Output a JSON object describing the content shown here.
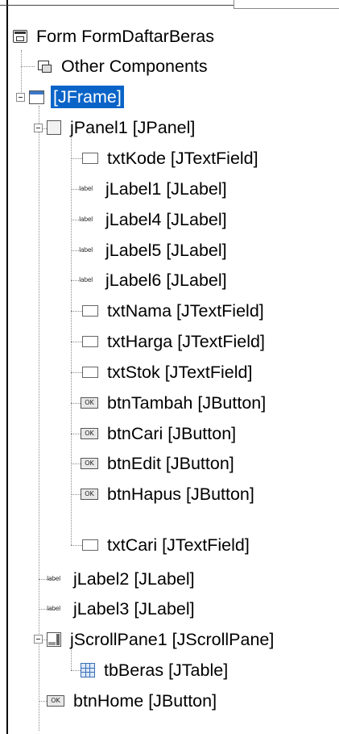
{
  "tree": {
    "root": {
      "label": "Form FormDaftarBeras",
      "icon": "form-icon"
    },
    "other_components": {
      "label": "Other Components",
      "icon": "other-components-icon"
    },
    "jframe": {
      "label": "[JFrame]",
      "icon": "jframe-icon",
      "selected": true
    },
    "jpanel1": {
      "label": "jPanel1 [JPanel]",
      "icon": "jpanel-icon",
      "children": [
        {
          "label": "txtKode [JTextField]",
          "icon": "textfield-icon"
        },
        {
          "label": "jLabel1 [JLabel]",
          "icon": "label-icon"
        },
        {
          "label": "jLabel4 [JLabel]",
          "icon": "label-icon"
        },
        {
          "label": "jLabel5 [JLabel]",
          "icon": "label-icon"
        },
        {
          "label": "jLabel6 [JLabel]",
          "icon": "label-icon"
        },
        {
          "label": "txtNama [JTextField]",
          "icon": "textfield-icon"
        },
        {
          "label": "txtHarga [JTextField]",
          "icon": "textfield-icon"
        },
        {
          "label": "txtStok [JTextField]",
          "icon": "textfield-icon"
        },
        {
          "label": "btnTambah [JButton]",
          "icon": "button-icon"
        },
        {
          "label": "btnCari [JButton]",
          "icon": "button-icon"
        },
        {
          "label": "btnEdit [JButton]",
          "icon": "button-icon"
        },
        {
          "label": "btnHapus [JButton]",
          "icon": "button-icon"
        },
        {
          "label": "txtCari [JTextField]",
          "icon": "textfield-icon"
        }
      ]
    },
    "jlabel2": {
      "label": "jLabel2 [JLabel]",
      "icon": "label-icon"
    },
    "jlabel3": {
      "label": "jLabel3 [JLabel]",
      "icon": "label-icon"
    },
    "jscrollpane1": {
      "label": "jScrollPane1 [JScrollPane]",
      "icon": "scrollpane-icon",
      "children": [
        {
          "label": "tbBeras [JTable]",
          "icon": "table-icon"
        }
      ]
    },
    "btnhome": {
      "label": "btnHome [JButton]",
      "icon": "button-icon"
    },
    "icon_text": {
      "label_icon": "label",
      "button_icon": "OK"
    },
    "colors": {
      "selection": "#0a64c8",
      "tree_line": "#8a8a8a",
      "table_icon": "#3a6fb5"
    }
  }
}
